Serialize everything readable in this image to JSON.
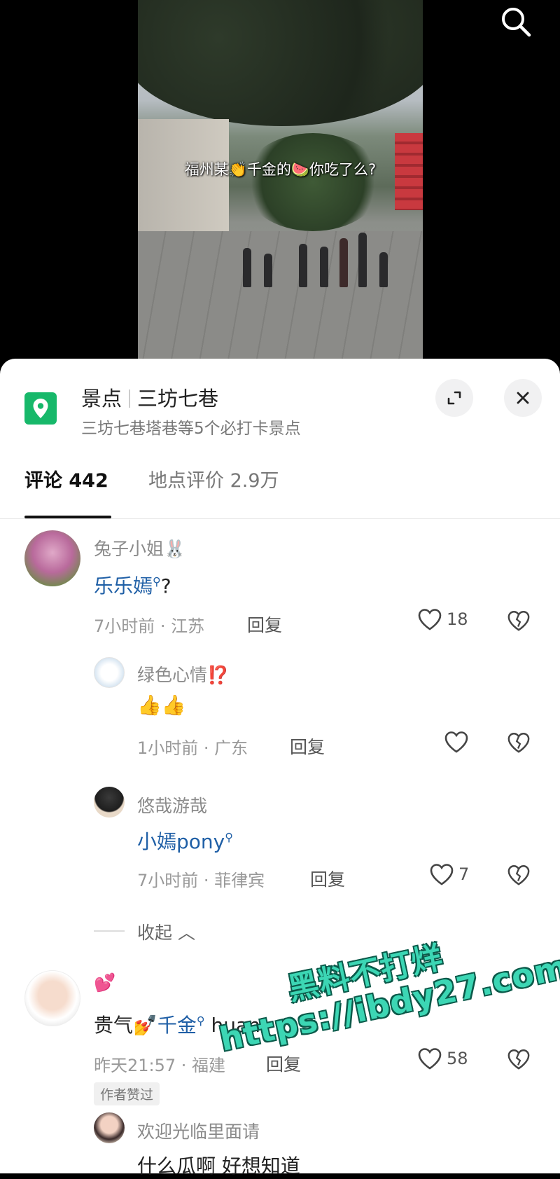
{
  "video": {
    "caption": "福州某👏千金的🍉你吃了么?"
  },
  "place": {
    "category": "景点",
    "name": "三坊七巷",
    "subtitle": "三坊七巷塔巷等5个必打卡景点",
    "icon": "location-pin-icon"
  },
  "tabs": [
    {
      "label": "评论 442",
      "active": true
    },
    {
      "label": "地点评价 2.9万",
      "active": false
    }
  ],
  "comments": [
    {
      "user": "兔子小姐🐰",
      "text_link": "乐乐嫣",
      "text_suffix": "?",
      "meta": "7小时前 · 江苏",
      "reply": "回复",
      "likes": "18"
    },
    {
      "user": "绿色心情⁉️",
      "text": "👍👍",
      "meta": "1小时前 · 广东",
      "reply": "回复",
      "likes": ""
    },
    {
      "user": "悠哉游哉",
      "text_link": "小嫣pony",
      "meta": "7小时前 · 菲律宾",
      "reply": "回复",
      "likes": "7"
    },
    {
      "user": "💕",
      "text_prefix": "贵气💅",
      "text_link": "千金",
      "text_suffix": " huan",
      "meta": "昨天21:57 · 福建",
      "reply": "回复",
      "likes": "58",
      "badge": "作者赞过"
    },
    {
      "user": "欢迎光临里面请",
      "text": "什么瓜啊 好想知道"
    }
  ],
  "collapse": "收起",
  "watermark": {
    "line1": "黑料不打烊",
    "line2": "https://ibdy27.com"
  },
  "colors": {
    "link": "#1f5fa6",
    "pin": "#17b86a",
    "watermark": "#3cd6b4"
  }
}
